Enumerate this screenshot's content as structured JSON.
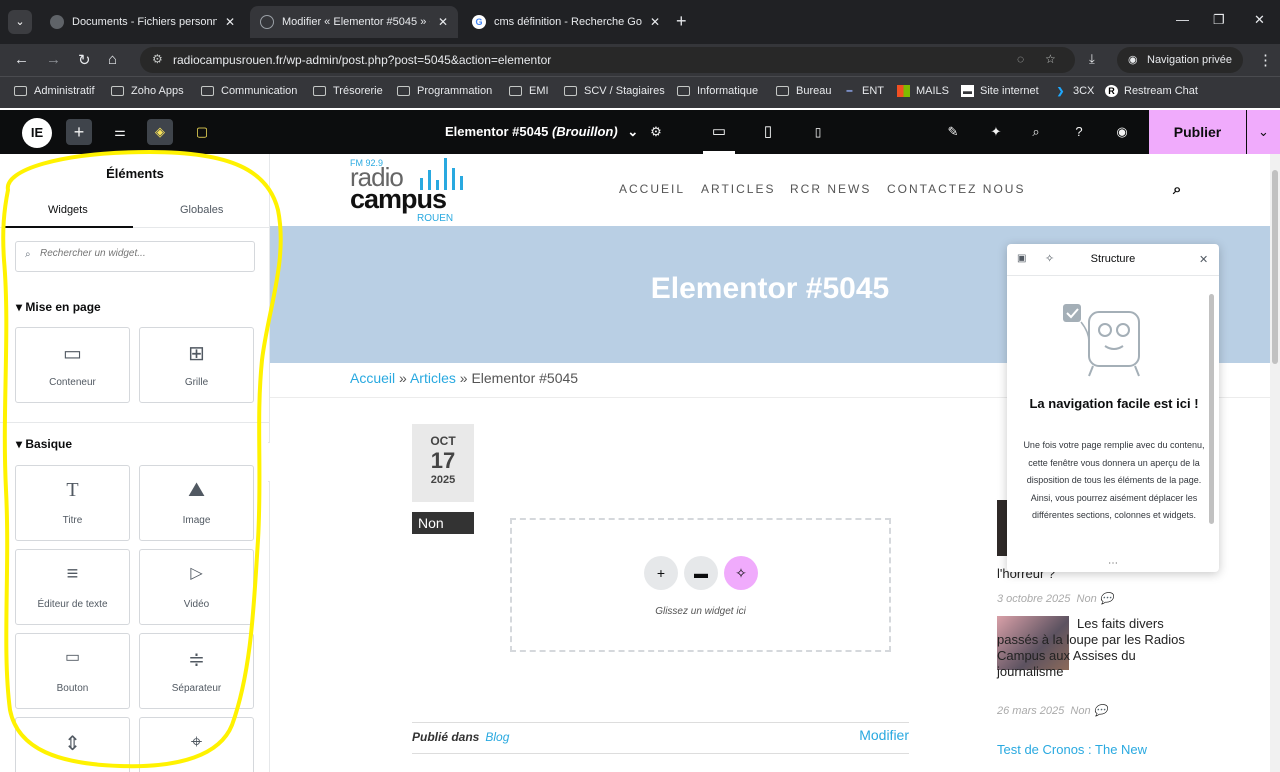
{
  "browser": {
    "tabs": [
      {
        "label": "Documents - Fichiers personnel",
        "active": false
      },
      {
        "label": "Modifier « Elementor #5045 » ‹",
        "active": true
      },
      {
        "label": "cms définition - Recherche Goo",
        "active": false
      }
    ],
    "url": "radiocampusrouen.fr/wp-admin/post.php?post=5045&action=elementor",
    "private_label": "Navigation privée",
    "bookmarks": [
      "Administratif",
      "Zoho Apps",
      "Communication",
      "Trésorerie",
      "Programmation",
      "EMI",
      "SCV / Stagiaires",
      "Informatique",
      "Bureau",
      "ENT",
      "MAILS",
      "Site internet",
      "3CX",
      "Restream Chat"
    ]
  },
  "editor": {
    "document_title": "Elementor #5045",
    "document_status": "(Brouillon)",
    "publish_label": "Publier"
  },
  "panel": {
    "title": "Éléments",
    "tabs": [
      "Widgets",
      "Globales"
    ],
    "search_placeholder": "Rechercher un widget...",
    "categories": [
      {
        "label": "Mise en page",
        "widgets": [
          "Conteneur",
          "Grille"
        ]
      },
      {
        "label": "Basique",
        "widgets": [
          "Titre",
          "Image",
          "Éditeur de texte",
          "Vidéo",
          "Bouton",
          "Séparateur"
        ]
      }
    ]
  },
  "site": {
    "logo_fm": "FM 92.9",
    "logo_line1": "radio",
    "logo_line2": "campus",
    "logo_line3": "ROUEN",
    "nav": [
      "ACCUEIL",
      "ARTICLES",
      "RCR NEWS",
      "CONTACTEZ NOUS"
    ],
    "hero_title": "Elementor #5045",
    "breadcrumb": {
      "home": "Accueil",
      "sep": "»",
      "section": "Articles",
      "current": "Elementor #5045"
    },
    "date": {
      "month": "OCT",
      "day": "17",
      "year": "2025"
    },
    "category_badge": "Non",
    "dropzone_label": "Glissez un widget ici",
    "published_in_label": "Publié dans",
    "published_in_value": "Blog",
    "edit_label": "Modifier",
    "sidebar_posts": [
      {
        "title": "l'horreur ?",
        "date": "3 octobre 2025",
        "cat": "Non"
      },
      {
        "title": "Les faits divers passés à la loupe par les Radios Campus aux Assises du journalisme",
        "date": "26 mars 2025",
        "cat": "Non"
      },
      {
        "title": "Test de Cronos : The New"
      }
    ]
  },
  "structure": {
    "title": "Structure",
    "heading": "La navigation facile est ici !",
    "body": "Une fois votre page remplie avec du contenu, cette fenêtre vous donnera un aperçu de la disposition de tous les éléments de la page. Ainsi, vous pourrez aisément déplacer les différentes sections, colonnes et widgets."
  },
  "colors": {
    "accent": "#f0abfc",
    "link": "#29a9e0",
    "hero_bg": "#b9cfe4",
    "annotation": "#fff200"
  }
}
